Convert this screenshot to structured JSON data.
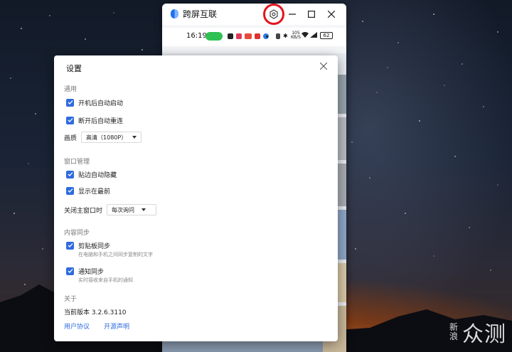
{
  "mirror_window": {
    "title": "跨屏互联",
    "status_bar": {
      "time": "16:19",
      "net_top": "105",
      "net_bottom": "KB/S",
      "battery": "62"
    }
  },
  "settings": {
    "title": "设置",
    "general": {
      "heading": "通用",
      "autostart_label": "开机后自动启动",
      "autostart_checked": true,
      "reconnect_label": "断开后自动重连",
      "reconnect_checked": true,
      "quality_label": "画质",
      "quality_value": "高清（1080P）"
    },
    "window": {
      "heading": "窗口管理",
      "autohide_label": "贴边自动隐藏",
      "autohide_checked": true,
      "ontop_label": "显示在最前",
      "ontop_checked": true,
      "close_label": "关闭主窗口时",
      "close_value": "每次询问"
    },
    "sync": {
      "heading": "内容同步",
      "clipboard_label": "剪贴板同步",
      "clipboard_desc": "在电脑和手机之间同步复制的文字",
      "clipboard_checked": true,
      "notify_label": "通知同步",
      "notify_desc": "实时接收来自手机的通知",
      "notify_checked": true
    },
    "about": {
      "heading": "关于",
      "version": "当前版本 3.2.6.3110",
      "user_agreement": "用户协议",
      "open_source": "开源声明"
    }
  },
  "watermark": {
    "small": "新浪",
    "big": "众测"
  },
  "colors": {
    "accent": "#2f6bde",
    "highlight_ring": "#e3141b",
    "cast_pill": "#2fc153"
  }
}
